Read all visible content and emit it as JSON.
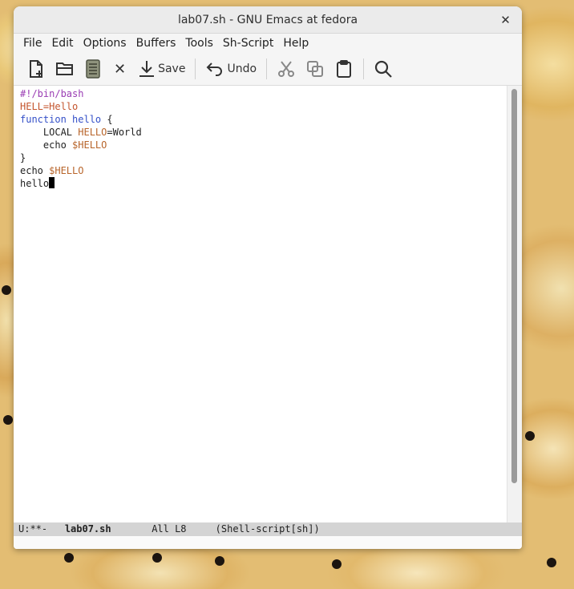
{
  "window": {
    "title": "lab07.sh - GNU Emacs at fedora",
    "close_glyph": "✕"
  },
  "menubar": {
    "items": [
      "File",
      "Edit",
      "Options",
      "Buffers",
      "Tools",
      "Sh-Script",
      "Help"
    ]
  },
  "toolbar": {
    "icons": [
      "new-file-icon",
      "open-folder-icon",
      "save-buffer-icon",
      "close-icon",
      "save-down-arrow-icon",
      "undo-arrow-icon",
      "cut-scissors-icon",
      "copy-icon",
      "paste-clipboard-icon",
      "search-icon"
    ],
    "close_glyph": "✕",
    "save_label": "Save",
    "undo_label": "Undo"
  },
  "buffer": {
    "lines": [
      [
        {
          "t": "#!/bin/bash",
          "c": "purple"
        }
      ],
      [
        {
          "t": "HELL=Hello",
          "c": "pink"
        }
      ],
      [
        {
          "t": "function",
          "c": "blue"
        },
        {
          "t": " "
        },
        {
          "t": "hello",
          "c": "blue"
        },
        {
          "t": " {"
        }
      ],
      [
        {
          "t": "    LOCAL "
        },
        {
          "t": "HELLO",
          "c": "orange"
        },
        {
          "t": "=World"
        }
      ],
      [
        {
          "t": "    echo "
        },
        {
          "t": "$HELLO",
          "c": "orange"
        }
      ],
      [
        {
          "t": "}"
        }
      ],
      [
        {
          "t": "echo "
        },
        {
          "t": "$HELLO",
          "c": "orange"
        }
      ],
      [
        {
          "t": "hello"
        }
      ]
    ]
  },
  "modeline": {
    "status": "U:**-",
    "buffer_name": "lab07.sh",
    "position": "All L8",
    "mode": "(Shell-script[sh])"
  },
  "colors": {
    "purple": "#9a3cb3",
    "blue": "#3450c8",
    "orange": "#b8652b",
    "pink": "#c4552e"
  }
}
